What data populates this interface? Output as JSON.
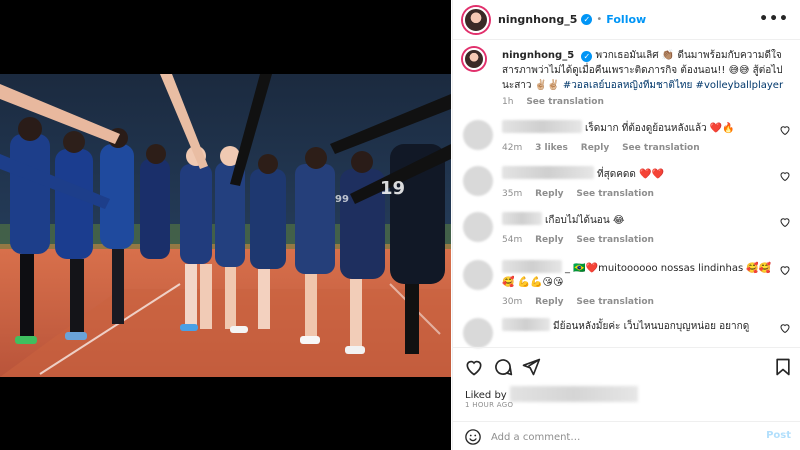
{
  "post": {
    "username": "ningnhong_5",
    "follow_label": "Follow",
    "more_label": "•••"
  },
  "caption": {
    "username": "ningnhong_5",
    "text": "พวกเธอมันเลิศ 👏🏽 ดีนมาพร้อมกับความดีใจ สารภาพว่าไม่ได้ดูเมื่อคืนเพราะติดภารกิจ ต้องนอน!! 😅😅 สู้ต่อไปนะสาว ✌🏼✌🏼",
    "hashtags": "#วอลเลย์บอลหญิงทีมชาติไทย #volleyballplayer",
    "time": "1h",
    "see_translation": "See translation"
  },
  "comments": [
    {
      "text": "เร็ดมาก ที่ต้องดูย้อนหลังแล้ว ❤️🔥",
      "time": "42m",
      "likes": "3 likes",
      "reply": "Reply",
      "see_translation": "See translation"
    },
    {
      "text": "ที่สุดคดด ❤️❤️",
      "time": "35m",
      "reply": "Reply",
      "see_translation": "See translation"
    },
    {
      "text": "เกือบไม่ได้นอน 😂",
      "time": "54m",
      "reply": "Reply",
      "see_translation": "See translation"
    },
    {
      "text": "_ 🇧🇷❤️muitoooooo nossas lindinhas 🥰🥰🥰 💪💪😘😘",
      "time": "30m",
      "reply": "Reply",
      "see_translation": "See translation"
    },
    {
      "text": "มีย้อนหลังมั้ยค่ะ เว็บไหนบอกบุญหน่อย อยากดู",
      "time": "",
      "reply": "",
      "see_translation": ""
    }
  ],
  "footer": {
    "liked_by": "Liked by",
    "time_ago": "1 HOUR AGO",
    "add_comment_placeholder": "Add a comment…",
    "post_label": "Post"
  },
  "icons": {
    "heart": "heart-icon",
    "comment": "comment-icon",
    "share": "share-icon",
    "save": "bookmark-icon",
    "emoji": "smiley-icon",
    "verified": "verified-badge-icon"
  },
  "colors": {
    "accent": "#0095f6",
    "hashtag": "#00376b",
    "muted": "#8e8e8e",
    "post_disabled": "#b2dffc"
  }
}
